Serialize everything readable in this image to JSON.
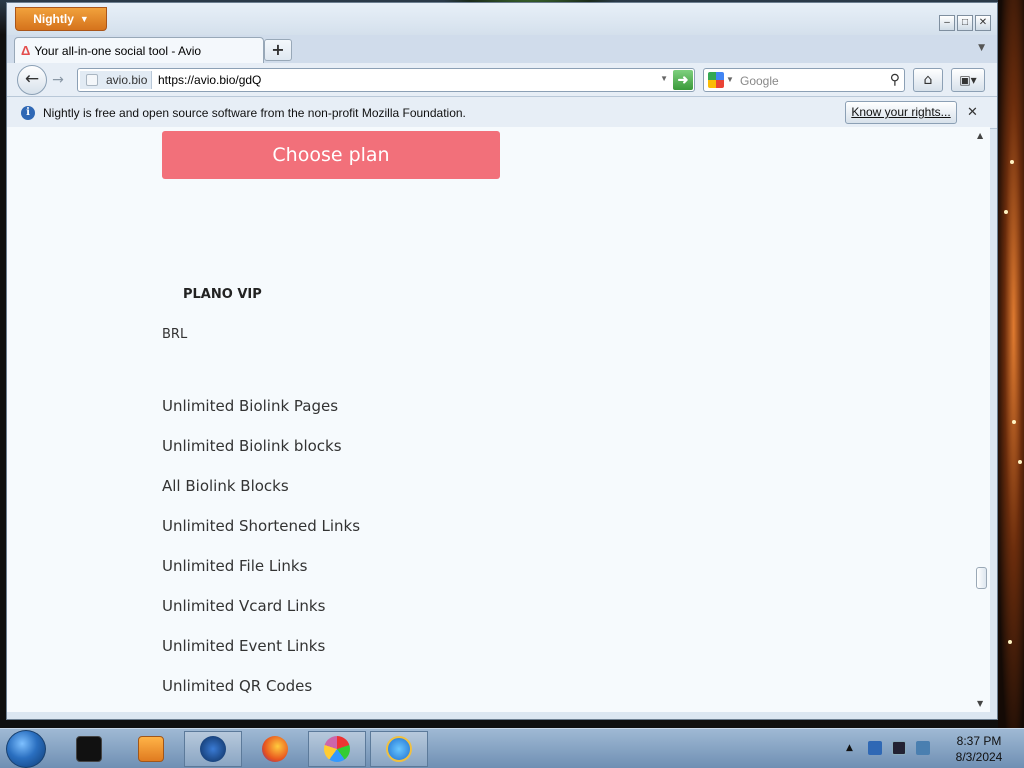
{
  "browser": {
    "app_button_label": "Nightly",
    "tab_title": "Your all-in-one social tool - Avio",
    "site_identity": "avio.bio",
    "url": "https://avio.bio/gdQ",
    "search_placeholder": "Google",
    "notice_text": "Nightly is free and open source software from the non-profit Mozilla Foundation.",
    "notice_button": "Know your rights...",
    "brand_color": "#d5731c"
  },
  "page": {
    "choose_plan_label": "Choose plan",
    "plan_name": "PLANO VIP",
    "plan_currency": "BRL",
    "features": [
      "Unlimited Biolink Pages",
      "Unlimited Biolink blocks",
      "All Biolink Blocks",
      "Unlimited Shortened Links",
      "Unlimited File Links",
      "Unlimited Vcard Links",
      "Unlimited Event Links",
      "Unlimited QR Codes"
    ],
    "accent_color": "#f2707a"
  },
  "taskbar": {
    "time": "8:37 PM",
    "date": "8/3/2024",
    "apps": [
      "terminal",
      "media-player",
      "thunderbird",
      "firefox",
      "paint",
      "internet-explorer"
    ]
  }
}
